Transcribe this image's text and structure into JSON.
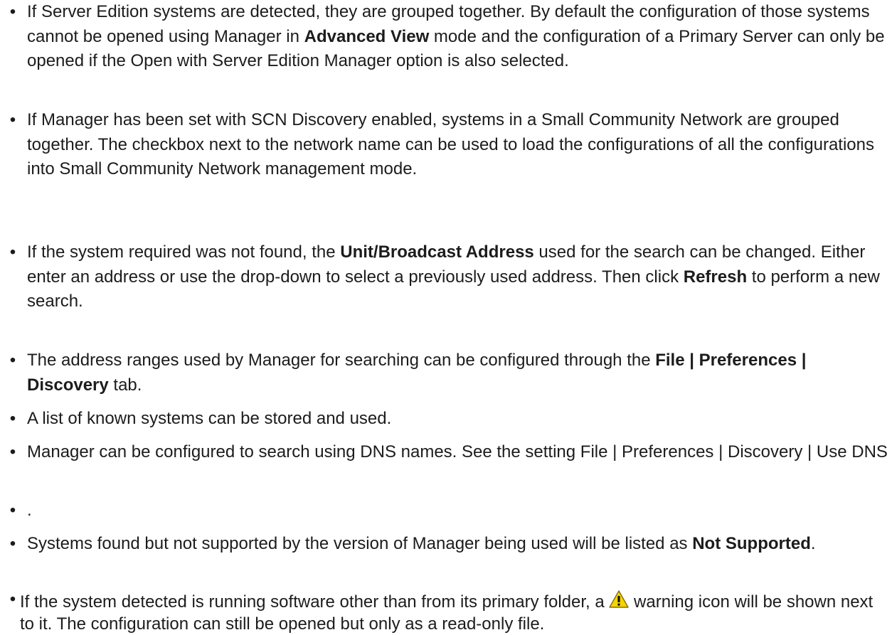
{
  "bullet_char": "•",
  "items": [
    [
      {
        "text": "If Server Edition systems are detected, they are grouped together. By default the configuration of those systems cannot be opened using Manager in "
      },
      {
        "text": "Advanced View",
        "bold": true
      },
      {
        "text": " mode and the configuration of a Primary Server can only be opened if the Open with Server Edition Manager option is also selected."
      }
    ],
    [
      {
        "text": "If Manager has been set with SCN Discovery enabled, systems in a Small Community Network are grouped together. The checkbox next to the network name can be used to load the configurations of all the configurations into Small Community Network management mode."
      }
    ],
    [
      {
        "text": "If the system required was not found, the "
      },
      {
        "text": "Unit/Broadcast Address",
        "bold": true
      },
      {
        "text": " used for the search can be changed. Either enter an address or use the drop-down to select a previously used address. Then click "
      },
      {
        "text": "Refresh",
        "bold": true
      },
      {
        "text": " to perform a new search."
      }
    ],
    [
      {
        "text": "The address ranges used by Manager for searching can be configured through the "
      },
      {
        "text": "File | Preferences | Discovery",
        "bold": true
      },
      {
        "text": " tab."
      }
    ],
    [
      {
        "text": "A list of known systems can be stored and used."
      }
    ],
    [
      {
        "text": "Manager can be configured to search using DNS names. See the setting File | Preferences | Discovery | Use DNS"
      }
    ],
    [
      {
        "text": "."
      }
    ],
    [
      {
        "text": "Systems found but not supported by the version of Manager being used will be listed as "
      },
      {
        "text": "Not Supported",
        "bold": true
      },
      {
        "text": "."
      }
    ],
    [
      {
        "text": "If the system detected is running software other than from its primary folder, a "
      },
      {
        "icon": "warning-icon"
      },
      {
        "text": " warning icon will be shown next to it. The configuration can still be opened but only as a read-only file."
      }
    ]
  ]
}
